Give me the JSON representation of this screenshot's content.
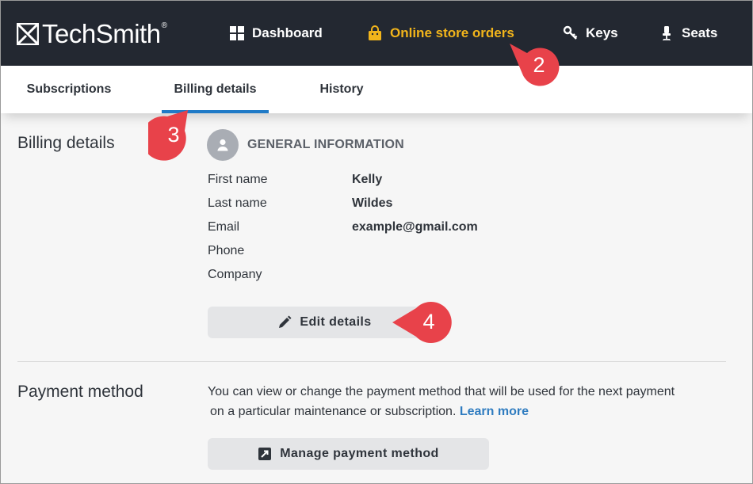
{
  "brand": {
    "name": "TechSmith",
    "reg": "®"
  },
  "topnav": {
    "items": [
      {
        "label": "Dashboard",
        "icon": "grid-icon",
        "active": false
      },
      {
        "label": "Online store orders",
        "icon": "shopping-bag-icon",
        "active": true
      },
      {
        "label": "Keys",
        "icon": "key-icon",
        "active": false
      },
      {
        "label": "Seats",
        "icon": "seat-icon",
        "active": false
      }
    ],
    "active_color": "#f2b51b",
    "background": "#232831"
  },
  "tabs": [
    {
      "label": "Subscriptions",
      "active": false
    },
    {
      "label": "Billing details",
      "active": true
    },
    {
      "label": "History",
      "active": false
    }
  ],
  "billing": {
    "section_title": "Billing details",
    "general_title": "GENERAL INFORMATION",
    "fields": [
      {
        "label": "First name",
        "value": "Kelly"
      },
      {
        "label": "Last name",
        "value": "Wildes"
      },
      {
        "label": "Email",
        "value": "example@gmail.com"
      },
      {
        "label": "Phone",
        "value": ""
      },
      {
        "label": "Company",
        "value": ""
      }
    ],
    "edit_button": "Edit details"
  },
  "payment": {
    "section_title": "Payment method",
    "description_line1": "You can view or change the payment method that will be used for the next payment",
    "description_line2": "on a particular maintenance or subscription.",
    "learn_more": "Learn more",
    "manage_button": "Manage payment method"
  },
  "callouts": [
    "2",
    "3",
    "4"
  ],
  "colors": {
    "accent": "#1f7ac7",
    "callout": "#e8424a",
    "link": "#2f7cc0"
  }
}
